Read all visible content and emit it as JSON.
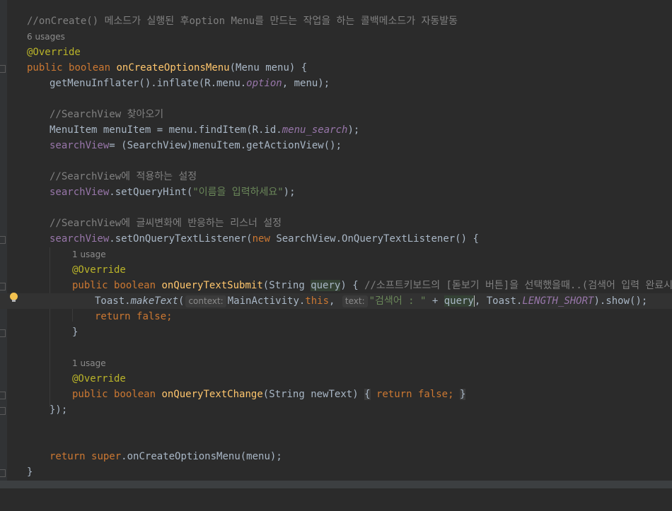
{
  "editor": {
    "comment_oncreate": "//onCreate() 메소드가 실행된 후option Menu를 만드는 작업을 하는 콜백메소드가 자동발동",
    "usages_6": "6 usages",
    "usages_1a": "1 usage",
    "usages_1b": "1 usage",
    "override": "@Override",
    "lines": {
      "l_public": "public",
      "l_boolean": "boolean",
      "l_method": "onCreateOptionsMenu",
      "l_params": "(Menu menu) {",
      "l_getmenu": "getMenuInflater().inflate(R.menu.",
      "l_option": "option",
      "l_getmenu_end": ", menu);",
      "l_cmt_sv": "//SearchView 찾아오기",
      "l_menuitem_a": "MenuItem menuItem = menu.findItem(R.id.",
      "l_menu_search": "menu_search",
      "l_menuitem_b": ");",
      "l_sv_field": "searchView",
      "l_sv_assign": "= (SearchView)menuItem.getActionView();",
      "l_cmt_setting": "//SearchView에 적용하는 설정",
      "l_sethint_a": ".setQueryHint(",
      "l_sethint_str": "\"이름을 입력하세요\"",
      "l_sethint_b": ");",
      "l_cmt_listener": "//SearchView에 글씨변화에 반응하는 리스너 설정",
      "l_setlistener": ".setOnQueryTextListener(",
      "l_new": "new",
      "l_listener_type": " SearchView.OnQueryTextListener() {",
      "l_submit": "onQueryTextSubmit",
      "l_submit_a": "(String ",
      "l_query": "query",
      "l_submit_b": ") { ",
      "l_submit_cmt": "//소프트키보드의 [돋보기 버튼]을 선택했을때..(검색어 입력 완료시)",
      "l_toast": "Toast.",
      "l_maketext": "makeText",
      "l_paren": "(",
      "l_hint_context": "context:",
      "l_main": "MainActivity.",
      "l_this": "this",
      "l_comma": ", ",
      "l_hint_text": "text:",
      "l_toast_str": "\"검색어 : \"",
      "l_plus": " + ",
      "l_toast_b": ", Toast.",
      "l_length": "LENGTH_SHORT",
      "l_toast_c": ").show();",
      "l_return": "return",
      "l_false": "false",
      "l_semi": ";",
      "l_close": "}",
      "l_change": "onQueryTextChange",
      "l_change_params": "(String newText) ",
      "l_open_brace": "{",
      "l_close_listener": "});",
      "l_super": "super",
      "l_super_call": ".onCreateOptionsMenu(menu);"
    }
  },
  "colors": {
    "background": "#2b2b2b",
    "keyword": "#cc7832",
    "function": "#ffc66d",
    "string": "#6a8759",
    "comment": "#808080",
    "annotation": "#bbb529",
    "field": "#9876aa"
  },
  "icons": {
    "intention": "lightbulb-icon"
  }
}
